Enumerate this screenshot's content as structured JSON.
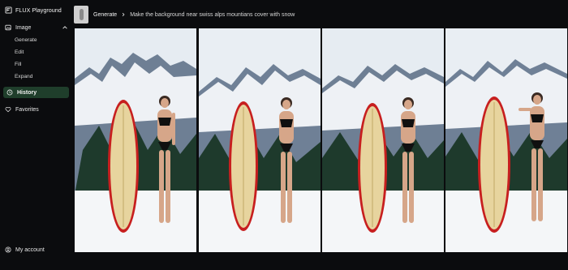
{
  "app": {
    "title": "FLUX Playground"
  },
  "sidebar": {
    "image_group": {
      "label": "Image",
      "items": [
        "Generate",
        "Edit",
        "Fill",
        "Expand"
      ]
    },
    "history_label": "History",
    "favorites_label": "Favorites",
    "account_label": "My account"
  },
  "breadcrumb": {
    "section": "Generate",
    "prompt": "Make the background near swiss alps mountians cover with snow"
  },
  "gallery": {
    "images": [
      {
        "alt": "generated-image-1"
      },
      {
        "alt": "generated-image-2"
      },
      {
        "alt": "generated-image-3"
      },
      {
        "alt": "generated-image-4"
      }
    ]
  },
  "colors": {
    "accent": "#1f3e2b",
    "sky": "#e9eef3",
    "snow": "#f4f6f8",
    "board_face": "#e7d49e",
    "board_rail": "#c71f1f",
    "forest": "#1e3a2c"
  }
}
